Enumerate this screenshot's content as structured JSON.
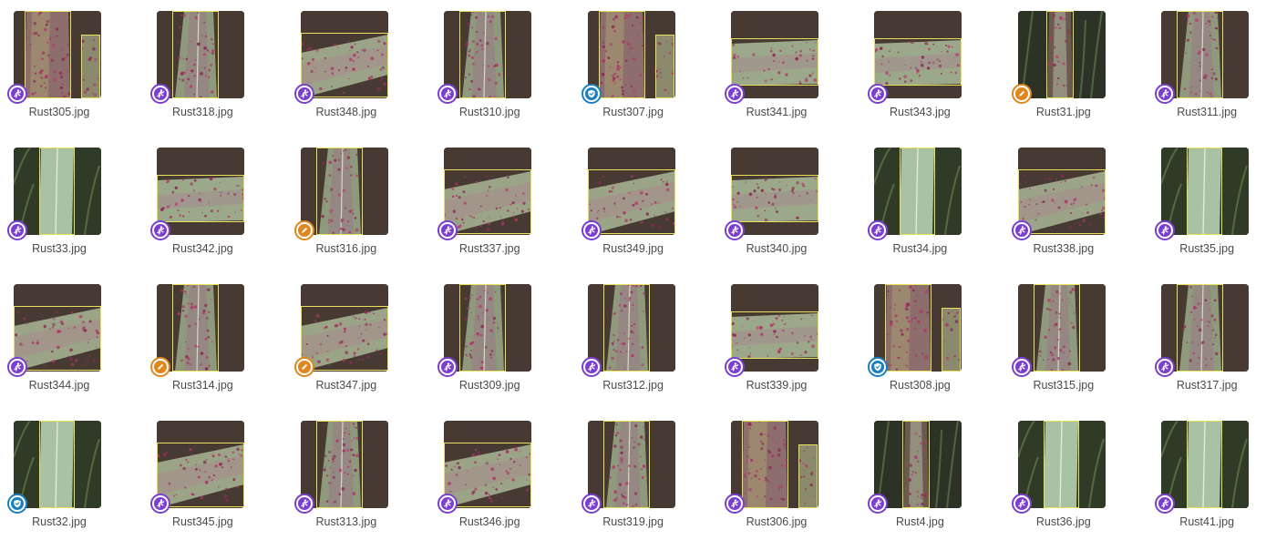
{
  "gallery": {
    "status_colors": {
      "ai": "#7b3fd0",
      "review": "#1a7fc1",
      "manual": "#e0861c"
    },
    "status_icons": {
      "ai": "running-person-icon",
      "review": "shield-check-icon",
      "manual": "pencil-icon"
    },
    "items": [
      {
        "name": "Rust305.jpg",
        "status": "ai",
        "scene": "v-multi"
      },
      {
        "name": "Rust318.jpg",
        "status": "ai",
        "scene": "v-single"
      },
      {
        "name": "Rust348.jpg",
        "status": "ai",
        "scene": "h-diag"
      },
      {
        "name": "Rust310.jpg",
        "status": "ai",
        "scene": "v-single"
      },
      {
        "name": "Rust307.jpg",
        "status": "review",
        "scene": "v-multi"
      },
      {
        "name": "Rust341.jpg",
        "status": "ai",
        "scene": "h-flat"
      },
      {
        "name": "Rust343.jpg",
        "status": "ai",
        "scene": "h-flat"
      },
      {
        "name": "Rust31.jpg",
        "status": "manual",
        "scene": "v-dark"
      },
      {
        "name": "Rust311.jpg",
        "status": "ai",
        "scene": "v-single"
      },
      {
        "name": "Rust33.jpg",
        "status": "ai",
        "scene": "v-green"
      },
      {
        "name": "Rust342.jpg",
        "status": "ai",
        "scene": "h-flat"
      },
      {
        "name": "Rust316.jpg",
        "status": "manual",
        "scene": "v-single"
      },
      {
        "name": "Rust337.jpg",
        "status": "ai",
        "scene": "h-diag"
      },
      {
        "name": "Rust349.jpg",
        "status": "ai",
        "scene": "h-diag"
      },
      {
        "name": "Rust340.jpg",
        "status": "ai",
        "scene": "h-flat"
      },
      {
        "name": "Rust34.jpg",
        "status": "ai",
        "scene": "v-green"
      },
      {
        "name": "Rust338.jpg",
        "status": "ai",
        "scene": "h-diag"
      },
      {
        "name": "Rust35.jpg",
        "status": "ai",
        "scene": "v-green"
      },
      {
        "name": "Rust344.jpg",
        "status": "ai",
        "scene": "h-diag"
      },
      {
        "name": "Rust314.jpg",
        "status": "manual",
        "scene": "v-single"
      },
      {
        "name": "Rust347.jpg",
        "status": "manual",
        "scene": "h-diag"
      },
      {
        "name": "Rust309.jpg",
        "status": "ai",
        "scene": "v-single"
      },
      {
        "name": "Rust312.jpg",
        "status": "ai",
        "scene": "v-single"
      },
      {
        "name": "Rust339.jpg",
        "status": "ai",
        "scene": "h-flat"
      },
      {
        "name": "Rust308.jpg",
        "status": "review",
        "scene": "v-multi"
      },
      {
        "name": "Rust315.jpg",
        "status": "ai",
        "scene": "v-single"
      },
      {
        "name": "Rust317.jpg",
        "status": "ai",
        "scene": "v-single"
      },
      {
        "name": "Rust32.jpg",
        "status": "review",
        "scene": "v-green"
      },
      {
        "name": "Rust345.jpg",
        "status": "ai",
        "scene": "h-diag"
      },
      {
        "name": "Rust313.jpg",
        "status": "ai",
        "scene": "v-single"
      },
      {
        "name": "Rust346.jpg",
        "status": "ai",
        "scene": "h-diag"
      },
      {
        "name": "Rust319.jpg",
        "status": "ai",
        "scene": "v-single"
      },
      {
        "name": "Rust306.jpg",
        "status": "ai",
        "scene": "v-multi"
      },
      {
        "name": "Rust4.jpg",
        "status": "ai",
        "scene": "v-dark"
      },
      {
        "name": "Rust36.jpg",
        "status": "ai",
        "scene": "v-green"
      },
      {
        "name": "Rust41.jpg",
        "status": "ai",
        "scene": "v-green"
      }
    ]
  }
}
